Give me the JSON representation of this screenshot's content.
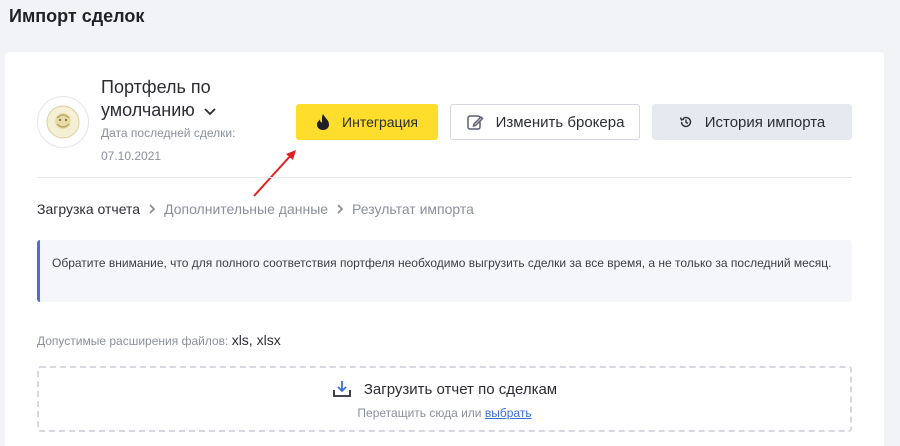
{
  "page": {
    "title": "Импорт сделок"
  },
  "portfolio": {
    "name": "Портфель по умолчанию",
    "last_deal_label": "Дата последней сделки:",
    "last_deal_date": "07.10.2021"
  },
  "buttons": {
    "integration": "Интеграция",
    "change_broker": "Изменить брокера",
    "import_history": "История импорта"
  },
  "steps": [
    {
      "label": "Загрузка отчета",
      "active": true
    },
    {
      "label": "Дополнительные данные",
      "active": false
    },
    {
      "label": "Результат импорта",
      "active": false
    }
  ],
  "notice": {
    "text": "Обратите внимание, что для полного соответствия портфеля необходимо выгрузить сделки за все время, а не только за последний месяц."
  },
  "extensions": {
    "label": "Допустимые расширения файлов:",
    "value": "xls, xlsx"
  },
  "dropzone": {
    "title": "Загрузить отчет по сделкам",
    "hint": "Перетащить сюда или",
    "link": "выбрать"
  },
  "colors": {
    "accent_yellow": "#ffdd2d",
    "notice_border": "#4a6fd6",
    "link": "#3b6fd6",
    "arrow": "#e02020"
  },
  "icons": {
    "avatar": "bank-logo-icon",
    "integration": "flame-icon",
    "change_broker": "edit-icon",
    "import_history": "history-icon",
    "dropzone": "upload-icon"
  }
}
